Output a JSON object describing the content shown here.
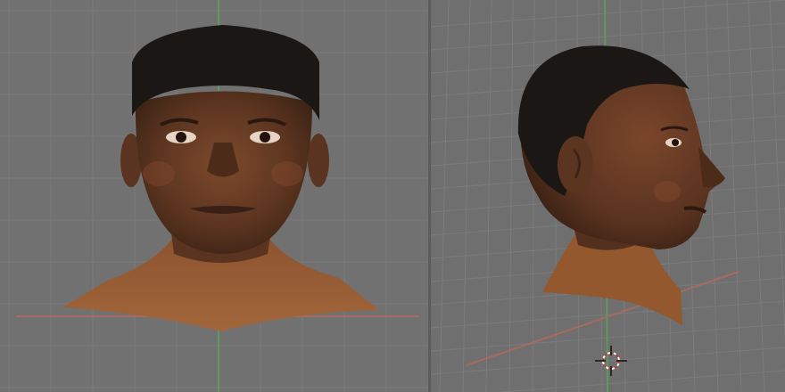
{
  "viewports": [
    {
      "view": "front",
      "model": "head",
      "gizmo": false
    },
    {
      "view": "right",
      "model": "head",
      "gizmo": true
    }
  ],
  "colors": {
    "background": "#717171",
    "grid_line": "#848484",
    "axis_x": "#b46a5e",
    "axis_z": "#5aa35a",
    "skin": "#6a3f24",
    "shirt": "#9a5a32",
    "hair": "#1b1714",
    "cursor_ring": "#cc3333"
  }
}
